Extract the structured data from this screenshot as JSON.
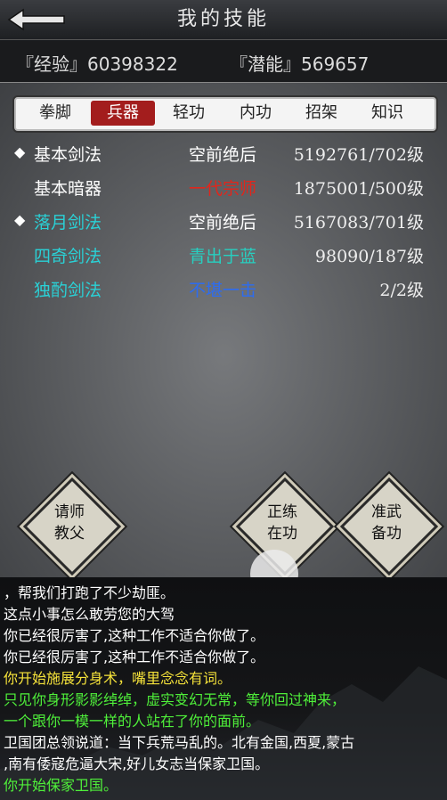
{
  "header": {
    "title": "我的技能"
  },
  "stats": {
    "exp": "『经验』60398322",
    "potential": "『潜能』569657"
  },
  "tabs": [
    {
      "label": "拳脚"
    },
    {
      "label": "兵器"
    },
    {
      "label": "轻功"
    },
    {
      "label": "内功"
    },
    {
      "label": "招架"
    },
    {
      "label": "知识"
    }
  ],
  "active_tab": "兵器",
  "skills": [
    {
      "bullet": "◆",
      "name": "基本剑法",
      "level": "空前绝后",
      "value": "5192761/702级",
      "name_color": "#ffffff",
      "level_color": "#ffffff"
    },
    {
      "bullet": "",
      "name": "基本暗器",
      "level": "一代宗师",
      "value": "1875001/500级",
      "name_color": "#ffffff",
      "level_color": "#e0261c"
    },
    {
      "bullet": "◆",
      "name": "落月剑法",
      "level": "空前绝后",
      "value": "5167083/701级",
      "name_color": "#2ad1d6",
      "level_color": "#ffffff"
    },
    {
      "bullet": "",
      "name": "四奇剑法",
      "level": "青出于蓝",
      "value": "98090/187级",
      "name_color": "#2ad1d6",
      "level_color": "#27cfc0"
    },
    {
      "bullet": "",
      "name": "独酌剑法",
      "level": "不堪一击",
      "value": "2/2级",
      "name_color": "#2ad1d6",
      "level_color": "#2d6cf0"
    }
  ],
  "actions": {
    "teacher": "请师\n教父",
    "practice": "正练\n在功",
    "prepare": "准武\n备功"
  },
  "log": [
    {
      "text": "，帮我们打跑了不少劫匪。",
      "color": "#ffffff"
    },
    {
      "text": "这点小事怎么敢劳您的大驾",
      "color": "#ffffff"
    },
    {
      "text": "你已经很厉害了,这种工作不适合你做了。",
      "color": "#ffffff"
    },
    {
      "text": "你已经很厉害了,这种工作不适合你做了。",
      "color": "#ffffff"
    },
    {
      "text": "你开始施展分身术，嘴里念念有词。",
      "color": "#f5e23a"
    },
    {
      "text": "只见你身形影影绰绰，虚实变幻无常，等你回过神来，",
      "color": "#4ff03a"
    },
    {
      "text": "一个跟你一模一样的人站在了你的面前。",
      "color": "#4ff03a"
    },
    {
      "text": "卫国团总领说道：当下兵荒马乱的。北有金国,西夏,蒙古",
      "color": "#ffffff"
    },
    {
      "text": ",南有倭寇危逼大宋,好儿女志当保家卫国。",
      "color": "#ffffff"
    },
    {
      "text": "你开始保家卫国。",
      "color": "#4ff03a"
    }
  ]
}
